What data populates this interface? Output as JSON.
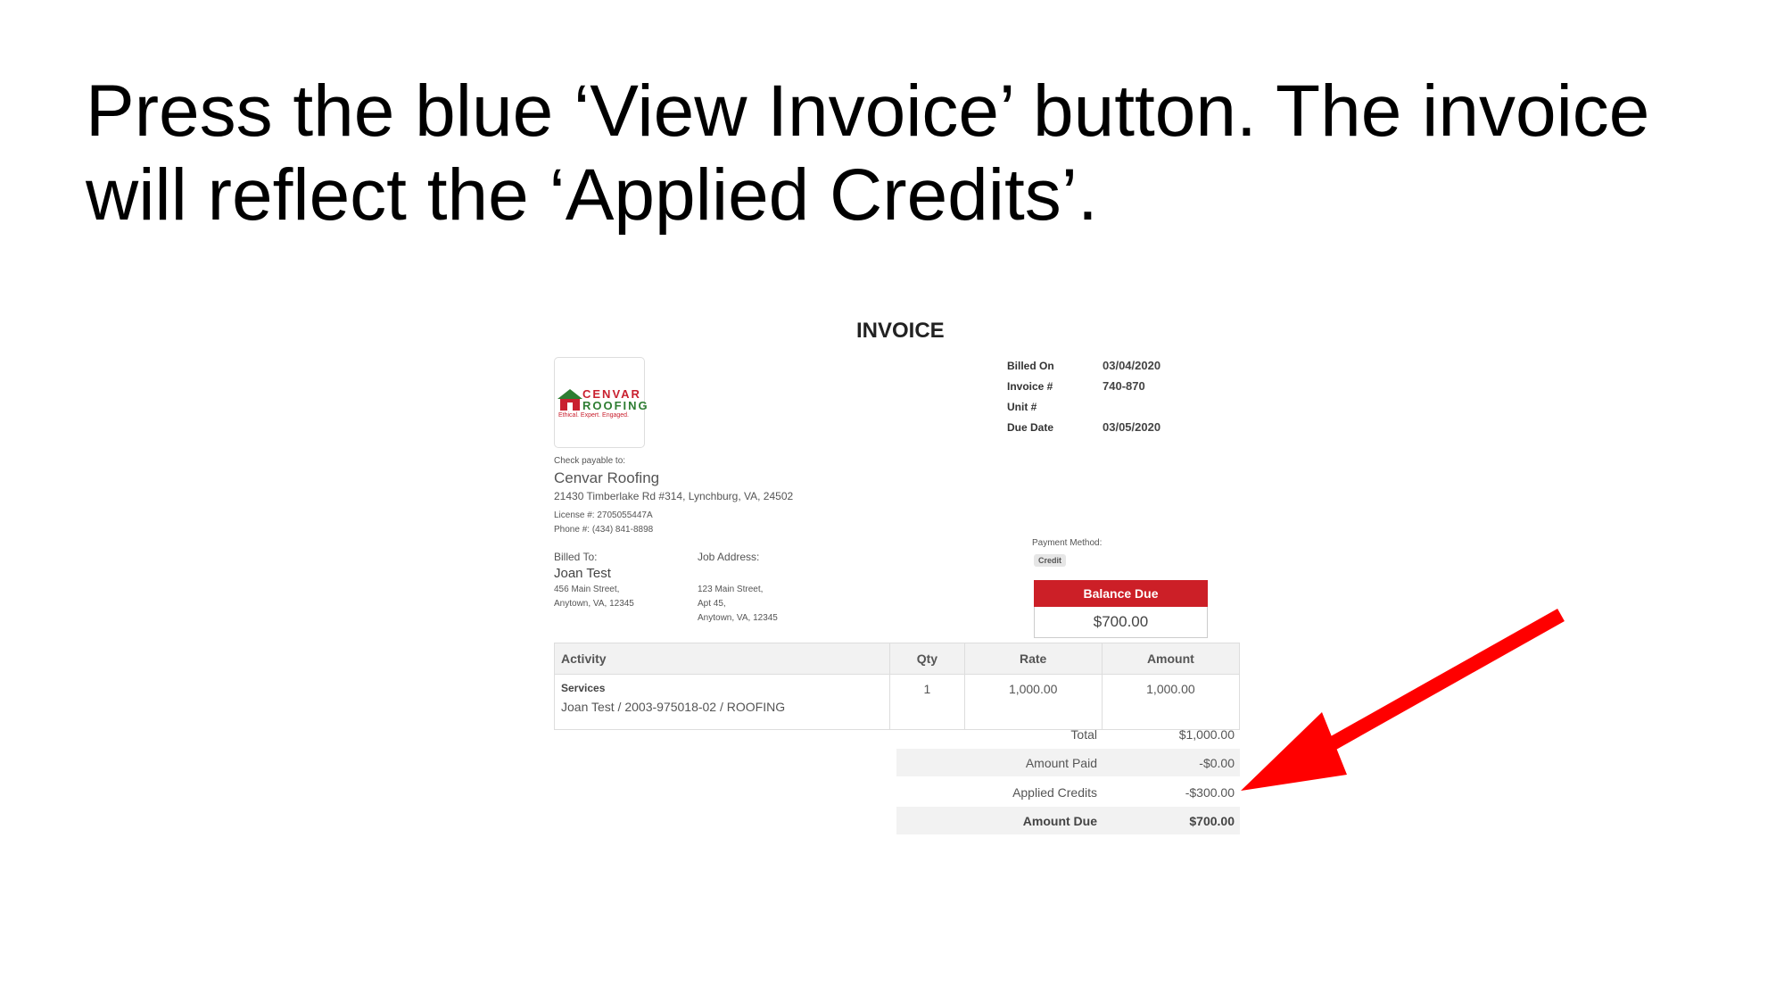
{
  "headline": "Press the blue ‘View Invoice’ button. The invoice will reflect the ‘Applied Credits’.",
  "invoice": {
    "title": "INVOICE",
    "logo": {
      "word1": "CENVAR",
      "word2": "ROOFING",
      "tagline": "Ethical. Expert. Engaged."
    },
    "meta": {
      "billed_on_label": "Billed On",
      "billed_on": "03/04/2020",
      "invoice_no_label": "Invoice #",
      "invoice_no": "740-870",
      "unit_label": "Unit #",
      "unit": "",
      "due_date_label": "Due Date",
      "due_date": "03/05/2020"
    },
    "payable": {
      "label": "Check payable to:",
      "company": "Cenvar Roofing",
      "address": "21430 Timberlake Rd #314, Lynchburg, VA, 24502",
      "license": "License #: 2705055447A",
      "phone": "Phone #: (434) 841-8898"
    },
    "billed_to": {
      "label": "Billed To:",
      "name": "Joan Test",
      "line1": "456 Main Street,",
      "line2": "Anytown, VA, 12345"
    },
    "job_address": {
      "label": "Job Address:",
      "line1": "123 Main Street,",
      "line2": "Apt 45,",
      "line3": "Anytown, VA, 12345"
    },
    "payment_method": {
      "label": "Payment Method:",
      "value": "Credit"
    },
    "balance_due": {
      "label": "Balance Due",
      "value": "$700.00"
    },
    "table": {
      "headers": {
        "activity": "Activity",
        "qty": "Qty",
        "rate": "Rate",
        "amount": "Amount"
      },
      "rows": [
        {
          "activity": "Services",
          "description": "Joan Test / 2003-975018-02 / ROOFING",
          "qty": "1",
          "rate": "1,000.00",
          "amount": "1,000.00"
        }
      ]
    },
    "totals": {
      "total_label": "Total",
      "total": "$1,000.00",
      "paid_label": "Amount Paid",
      "paid": "-$0.00",
      "credits_label": "Applied Credits",
      "credits": "-$300.00",
      "due_label": "Amount Due",
      "due": "$700.00"
    }
  },
  "colors": {
    "arrow": "#ff0000",
    "balance_header": "#cc1f27"
  }
}
